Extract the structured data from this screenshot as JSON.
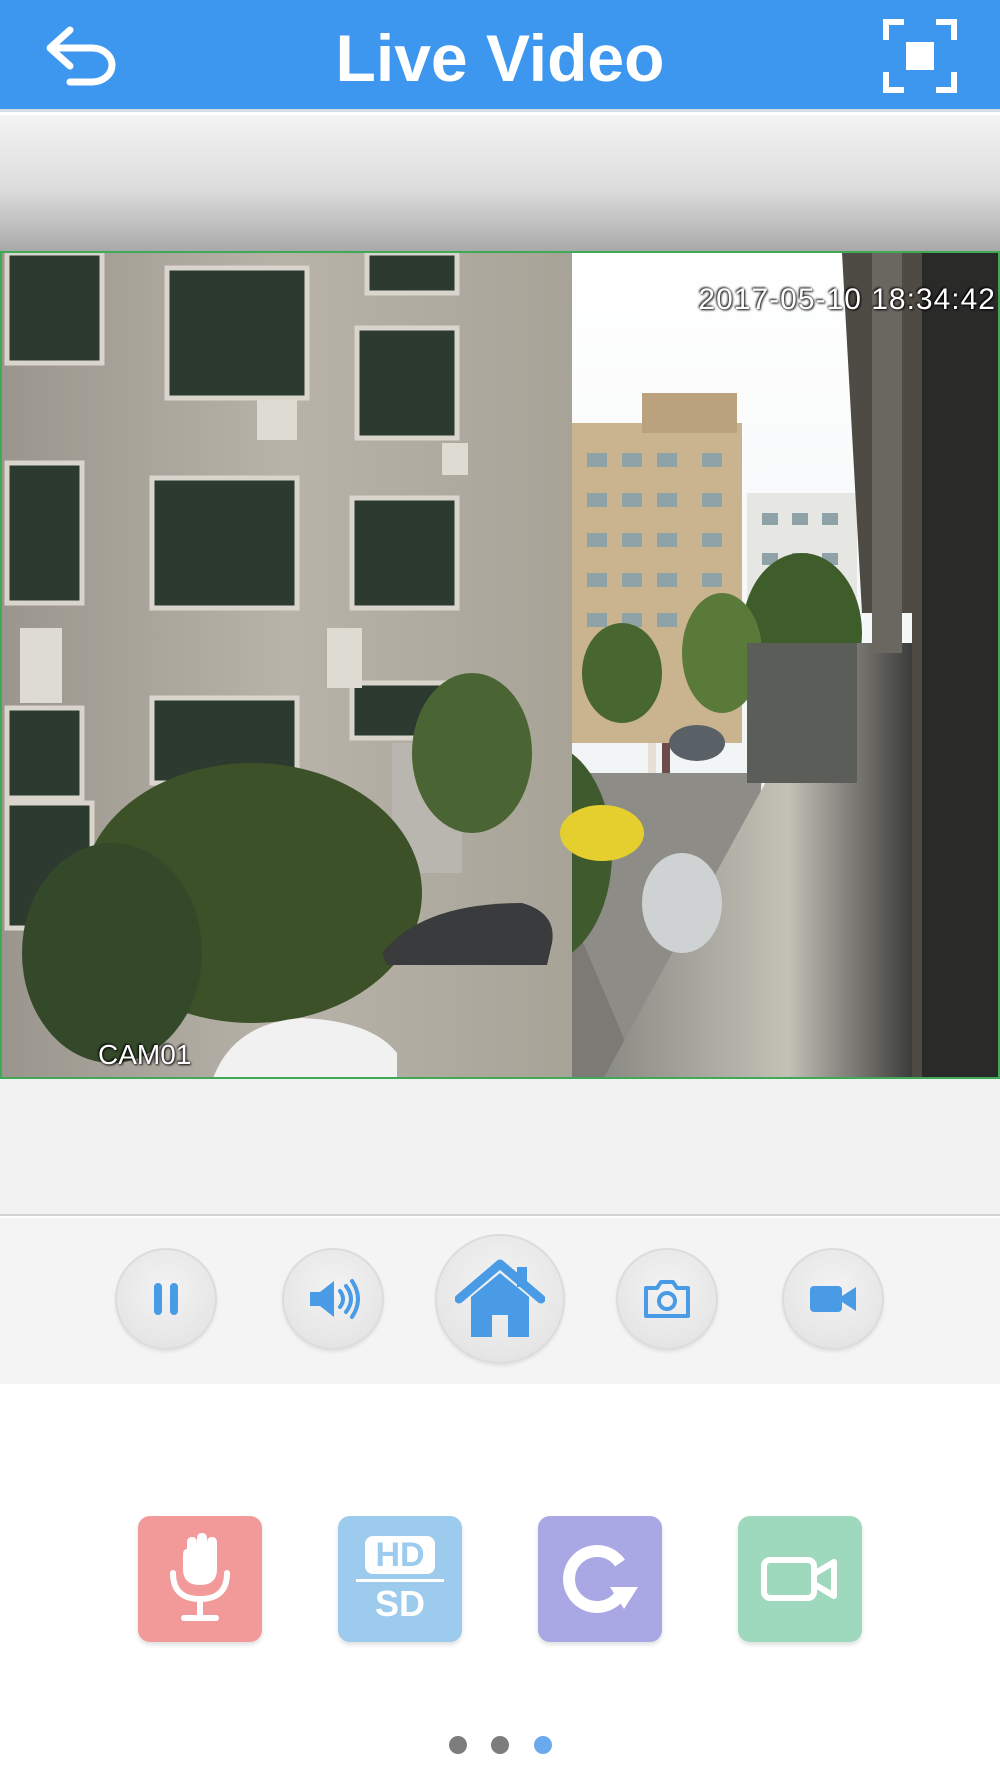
{
  "header": {
    "title": "Live Video",
    "back_icon": "back-arrow-icon",
    "fullscreen_icon": "fullscreen-icon",
    "background_color": "#3e97ef"
  },
  "video": {
    "timestamp": "2017-05-10 18:34:42",
    "camera_name": "CAM01",
    "border_color": "#3fa956"
  },
  "controls": {
    "icon_color": "#4a9be6",
    "buttons": [
      {
        "icon": "pause-icon"
      },
      {
        "icon": "speaker-icon"
      },
      {
        "icon": "home-icon"
      },
      {
        "icon": "camera-icon"
      },
      {
        "icon": "video-camera-icon"
      }
    ]
  },
  "functions": {
    "buttons": [
      {
        "icon": "microphone-icon",
        "color": "#f29a9a"
      },
      {
        "icon": "hd-sd-icon",
        "color": "#9ccbed",
        "hd_label": "HD",
        "sd_label": "SD"
      },
      {
        "icon": "rotate-icon",
        "color": "#aaa8e4"
      },
      {
        "icon": "record-icon",
        "color": "#9ed8bd"
      }
    ]
  },
  "pager": {
    "page_count": 3,
    "active_index": 2,
    "active_color": "#6aa9ee",
    "inactive_color": "#7d7d7d"
  }
}
